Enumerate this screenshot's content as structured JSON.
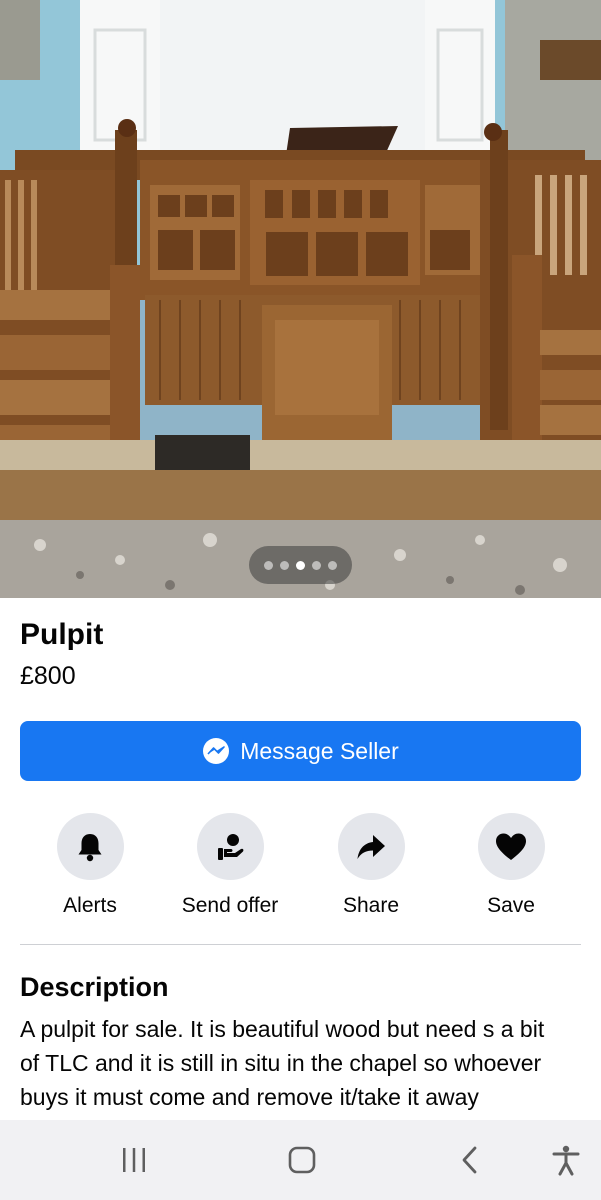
{
  "listing": {
    "image_alt": "Wooden church pulpit in a chapel",
    "image_count": 5,
    "current_image": 3,
    "title": "Pulpit",
    "price": "£800"
  },
  "message_button": {
    "label": "Message Seller",
    "icon": "messenger-icon"
  },
  "actions": [
    {
      "label": "Alerts",
      "icon": "bell-icon"
    },
    {
      "label": "Send offer",
      "icon": "offer-hand-icon"
    },
    {
      "label": "Share",
      "icon": "share-arrow-icon"
    },
    {
      "label": "Save",
      "icon": "heart-icon"
    }
  ],
  "description": {
    "heading": "Description",
    "text": "A pulpit for sale. It is beautiful wood but need s a bit of TLC and it is still in situ in the chapel so whoever buys it must come and remove it/take it away themselves"
  },
  "navbar": {
    "recents_icon": "recents-icon",
    "home_icon": "home-icon",
    "back_icon": "back-icon",
    "accessibility_icon": "accessibility-icon"
  },
  "colors": {
    "accent": "#1877f2",
    "action_circle": "#e4e6eb",
    "navbar_bg": "#f1f1f3"
  }
}
